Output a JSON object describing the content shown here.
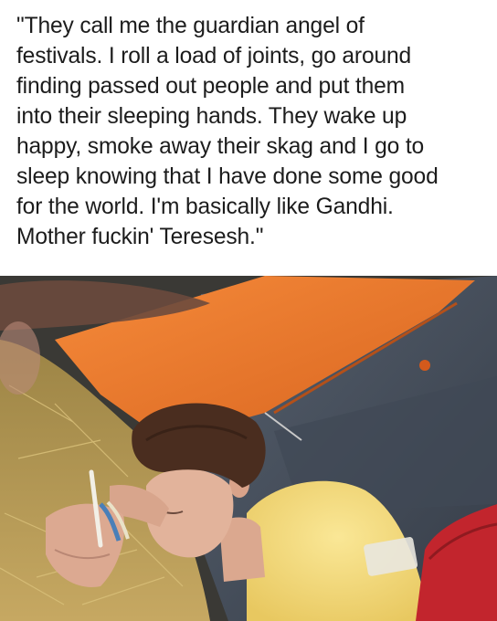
{
  "meme": {
    "caption": "\"They call me the guardian angel of\nfestivals. I roll a load of joints, go around\nfinding passed out people and put them\ninto their sleeping hands. They wake up\nhappy, smoke away their skag and I go to\nsleep knowing that I have done some good\nfor the world. I'm basically like Gandhi.\nMother fuckin' Teresesh.\"",
    "photo": {
      "description_icon": "sleeping-person-with-joint-photo",
      "colors": {
        "tent_orange": "#f07a2e",
        "tent_grey": "#4c5766",
        "hay": "#b89a55",
        "shirt_yellow": "#f6dc78",
        "hair": "#4a2d1f",
        "skin": "#e4b39a",
        "red_bag": "#c2252d"
      }
    }
  }
}
